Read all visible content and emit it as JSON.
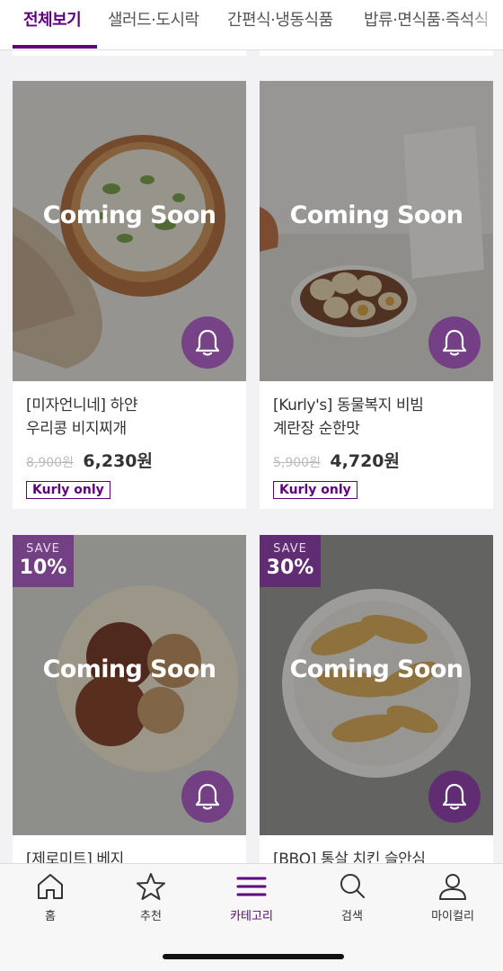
{
  "tabs": [
    {
      "label": "전체보기",
      "active": true
    },
    {
      "label": "샐러드·도시락",
      "active": false
    },
    {
      "label": "간편식·냉동식품",
      "active": false
    },
    {
      "label": "밥류·면식품·즉석식",
      "active": false
    }
  ],
  "products": [
    {
      "status": "Coming Soon",
      "name_line1": "[미자언니네] 하얀",
      "name_line2": "우리콩 비지찌개",
      "original_price": "8,900원",
      "price": "6,230원",
      "tag": "Kurly only"
    },
    {
      "status": "Coming Soon",
      "name_line1": "[Kurly's] 동물복지 비빔",
      "name_line2": "계란장 순한맛",
      "original_price": "5,900원",
      "price": "4,720원",
      "tag": "Kurly only"
    },
    {
      "status": "Coming Soon",
      "save_label": "SAVE",
      "save_percent": "10%",
      "name_line1": "[제로미트] 베지"
    },
    {
      "status": "Coming Soon",
      "save_label": "SAVE",
      "save_percent": "30%",
      "name_line1": "[BBQ] 통살 치킨 슬안심"
    }
  ],
  "nav": [
    {
      "label": "홈",
      "icon": "home-icon",
      "active": false
    },
    {
      "label": "추천",
      "icon": "star-icon",
      "active": false
    },
    {
      "label": "카테고리",
      "icon": "menu-icon",
      "active": true
    },
    {
      "label": "검색",
      "icon": "search-icon",
      "active": false
    },
    {
      "label": "마이컬리",
      "icon": "user-icon",
      "active": false
    }
  ],
  "colors": {
    "accent": "#5f0080",
    "background": "#f2f2f4"
  }
}
